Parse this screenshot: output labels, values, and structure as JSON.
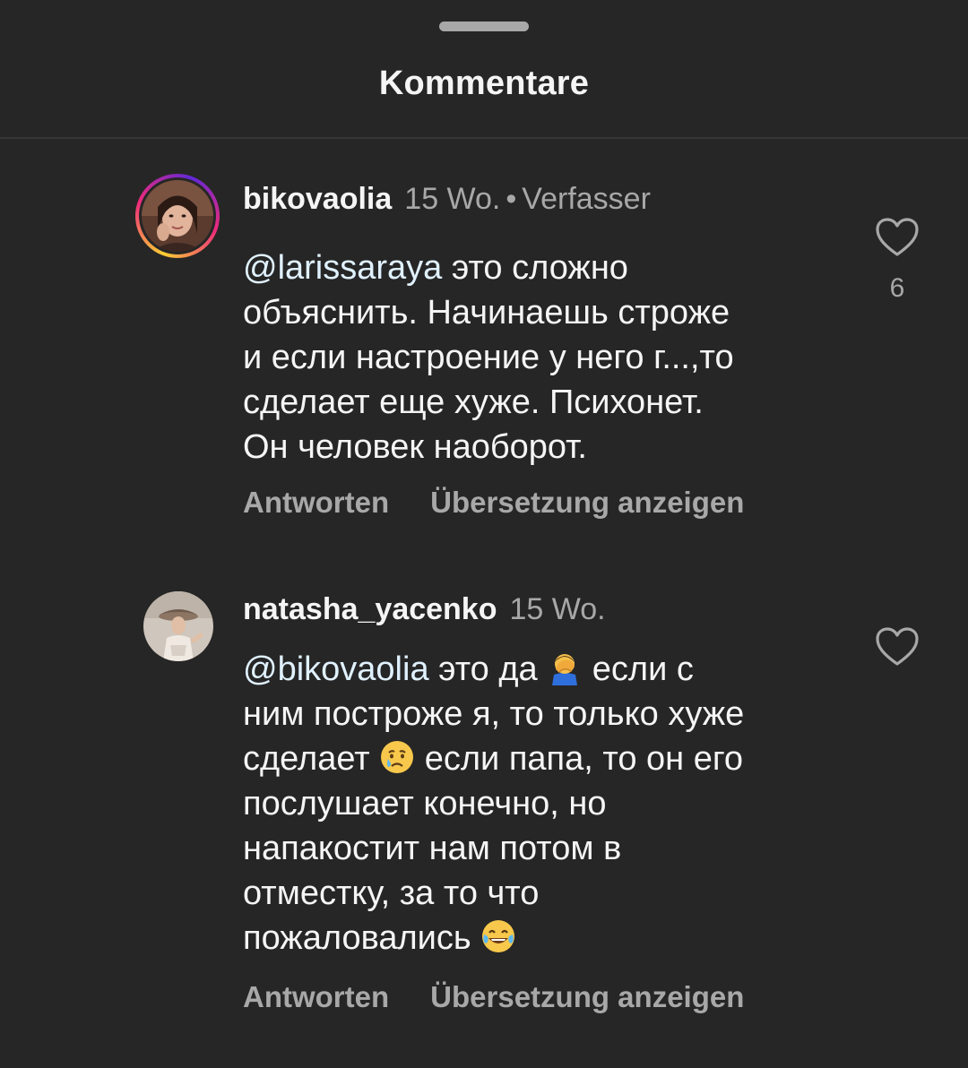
{
  "sheet": {
    "title": "Kommentare"
  },
  "comments": [
    {
      "username": "bikovaolia",
      "time": "15 Wo.",
      "separator": "•",
      "author_tag": "Verfasser",
      "mention": "@larissaraya",
      "lines": [
        " это сложно",
        "объяснить. Начинаешь строже",
        "и если настроение у него г...,то",
        "сделает еще хуже. Психонет.",
        "Он человек наоборот."
      ],
      "reply_label": "Antworten",
      "translate_label": "Übersetzung anzeigen",
      "like_icon": "heart-outline-icon",
      "like_count": "6"
    },
    {
      "username": "natasha_yacenko",
      "time": "15 Wo.",
      "mention": "@bikovaolia",
      "text_1": " это да ",
      "text_2": " если с",
      "text_3": "ним построже я, то только хуже",
      "text_4": "сделает ",
      "text_5": " если папа, то он его",
      "text_6": "послушает конечно, но",
      "text_7": "напакостит нам потом в",
      "text_8": "отместку, за то что",
      "text_9": "пожаловались ",
      "emojis": [
        "facepalm-emoji",
        "crying-face-emoji",
        "tears-of-joy-emoji"
      ],
      "reply_label": "Antworten",
      "translate_label": "Übersetzung anzeigen",
      "like_icon": "heart-outline-icon"
    }
  ],
  "colors": {
    "background": "#262626",
    "primary_text": "#f5f5f5",
    "secondary_text": "#a8a8a8",
    "mention": "#e0f1ff"
  }
}
